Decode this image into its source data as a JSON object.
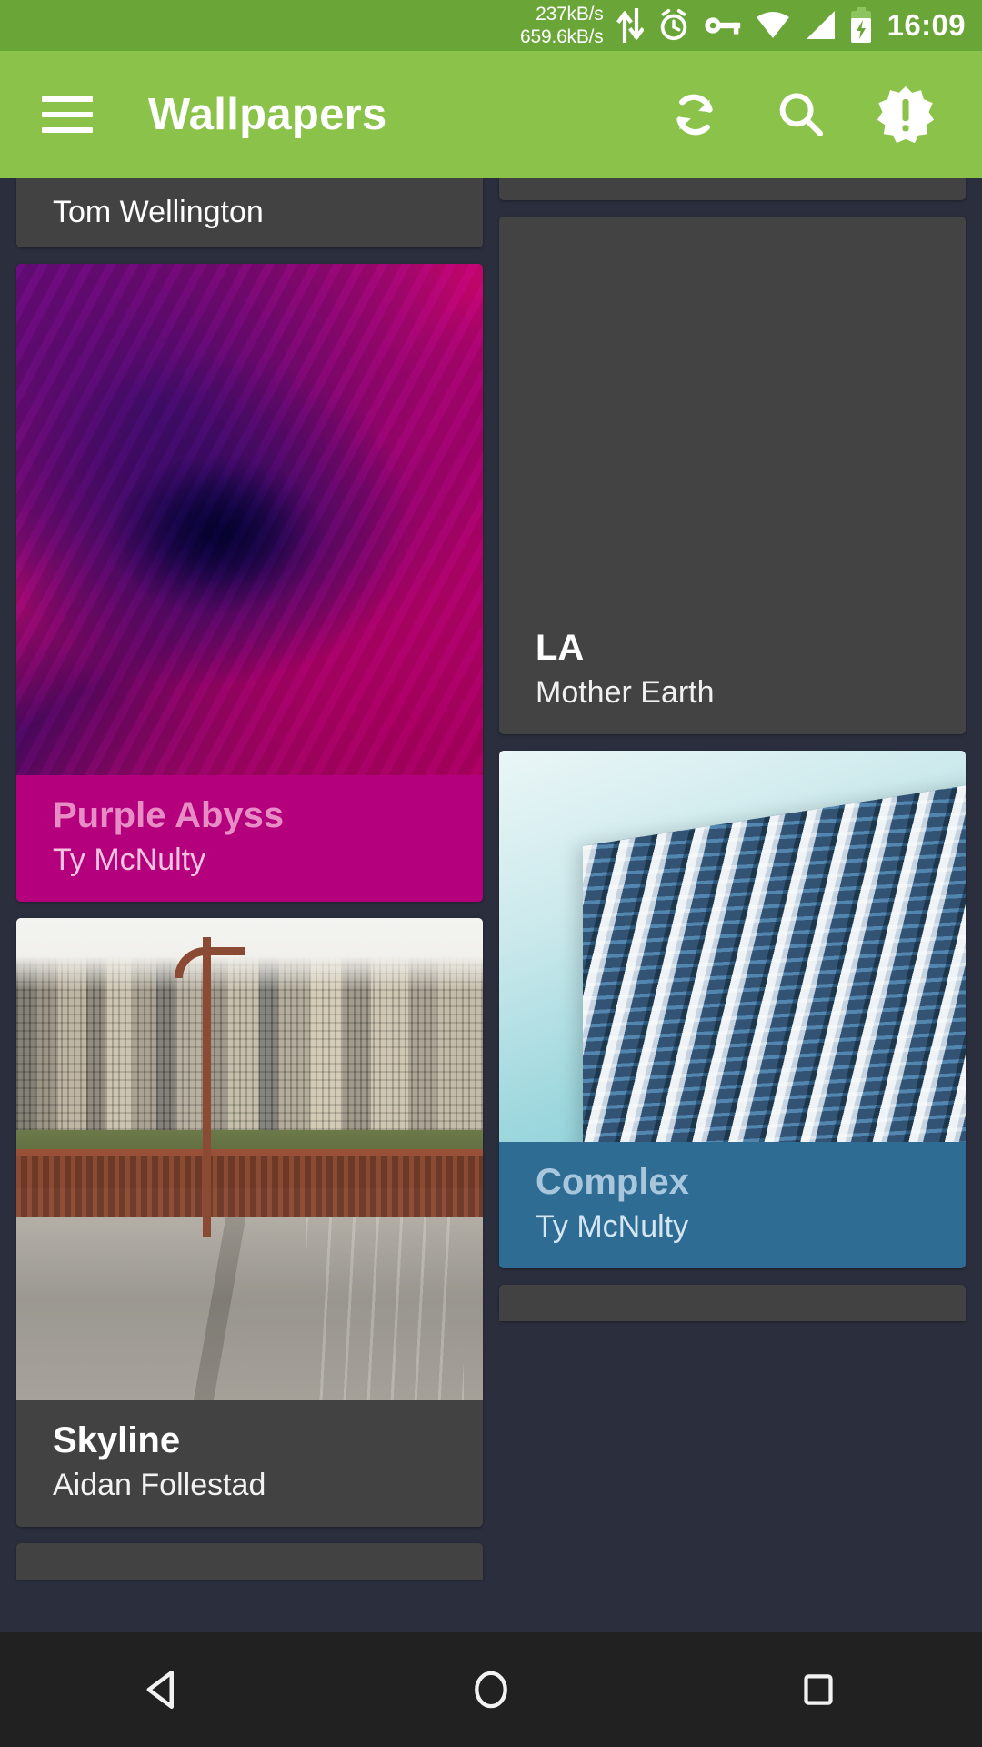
{
  "status_bar": {
    "network_down": "237kB/s",
    "network_up": "659.6kB/s",
    "icons": [
      "network-transfer-icon",
      "alarm-icon",
      "vpn-key-icon",
      "wifi-icon",
      "cell-signal-icon",
      "battery-charging-icon"
    ],
    "clock": "16:09",
    "background": "#6aa538"
  },
  "toolbar": {
    "menu_icon": "hamburger-menu-icon",
    "title": "Wallpapers",
    "actions": [
      {
        "name": "refresh-icon",
        "label": "Refresh"
      },
      {
        "name": "search-icon",
        "label": "Search"
      },
      {
        "name": "about-badge-icon",
        "label": "About"
      }
    ],
    "background": "#8bc34a"
  },
  "grid": {
    "left_column": [
      {
        "id": "partial-top",
        "author": "Tom Wellington",
        "kind": "partial-card"
      },
      {
        "id": "purple-abyss",
        "title": "Purple Abyss",
        "author": "Ty McNulty",
        "caption_color": "#b5007d",
        "kind": "image-card"
      },
      {
        "id": "skyline",
        "title": "Skyline",
        "author": "Aidan Follestad",
        "caption_color": "#424242",
        "kind": "image-card"
      },
      {
        "id": "partial-bottom-left",
        "kind": "partial-card"
      }
    ],
    "right_column": [
      {
        "id": "partial-top-right",
        "kind": "partial-card"
      },
      {
        "id": "la",
        "title": "LA",
        "author": "Mother Earth",
        "caption_color": "#434343",
        "kind": "placeholder-card"
      },
      {
        "id": "complex",
        "title": "Complex",
        "author": "Ty McNulty",
        "caption_color": "#2e6c94",
        "kind": "image-card"
      },
      {
        "id": "partial-bottom-right",
        "kind": "partial-card"
      }
    ]
  },
  "nav_bar": {
    "buttons": [
      {
        "name": "back-nav-icon",
        "label": "Back"
      },
      {
        "name": "home-nav-icon",
        "label": "Home"
      },
      {
        "name": "recents-nav-icon",
        "label": "Recents"
      }
    ],
    "background": "#212121"
  }
}
